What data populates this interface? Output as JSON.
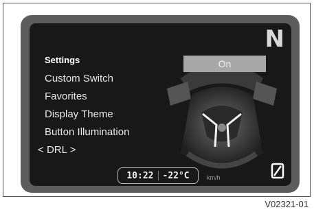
{
  "gear": "N",
  "menu": {
    "title": "Settings",
    "items": [
      "Custom Switch",
      "Favorites",
      "Display Theme",
      "Button Illumination"
    ],
    "current_left_arrow": "<",
    "current": "DRL",
    "current_right_arrow": ">"
  },
  "option_value": "On",
  "status": {
    "time": "10:22",
    "temperature": "-22°C",
    "speed_unit": "km/h"
  },
  "caption": "V02321-01"
}
